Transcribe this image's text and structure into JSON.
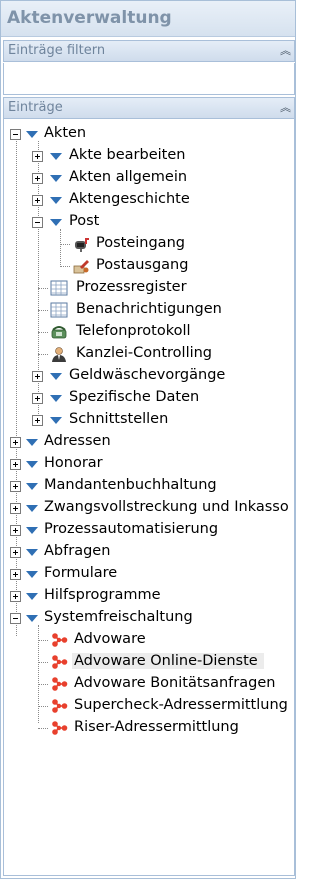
{
  "app": {
    "title": "Aktenverwaltung"
  },
  "filter_panel": {
    "label": "Einträge filtern",
    "collapse_glyph": "«",
    "input_value": ""
  },
  "entries_panel": {
    "label": "Einträge",
    "collapse_glyph": "«"
  },
  "tree": {
    "akten": {
      "label": "Akten",
      "children": {
        "akte_bearbeiten": "Akte bearbeiten",
        "akten_allgemein": "Akten allgemein",
        "aktengeschichte": "Aktengeschichte",
        "post": {
          "label": "Post",
          "children": {
            "posteingang": "Posteingang",
            "postausgang": "Postausgang"
          }
        },
        "prozessregister": "Prozessregister",
        "benachrichtigungen": "Benachrichtigungen",
        "telefonprotokoll": "Telefonprotokoll",
        "kanzlei_controlling": "Kanzlei-Controlling",
        "geldwaesche": "Geldwäschevorgänge",
        "spezifische_daten": "Spezifische Daten",
        "schnittstellen": "Schnittstellen"
      }
    },
    "adressen": "Adressen",
    "honorar": "Honorar",
    "mandantenbuchhaltung": "Mandantenbuchhaltung",
    "zwangsvollstreckung": "Zwangsvollstreckung und Inkasso",
    "prozessautomatisierung": "Prozessautomatisierung",
    "abfragen": "Abfragen",
    "formulare": "Formulare",
    "hilfsprogramme": "Hilfsprogramme",
    "systemfreischaltung": {
      "label": "Systemfreischaltung",
      "children": {
        "advoware": "Advoware",
        "advoware_online": "Advoware Online-Dienste",
        "bonitaet": "Advoware Bonitätsanfragen",
        "supercheck": "Supercheck-Adressermittlung",
        "riser": "Riser-Adressermittlung"
      }
    }
  },
  "colors": {
    "header_text": "#7f93a9",
    "panel_border": "#a9bfd9",
    "tree_arrow": "#2f6fb4",
    "node_icon": "#e8402d",
    "selection_bg": "#ececec"
  },
  "selected_item": "Advoware Online-Dienste"
}
